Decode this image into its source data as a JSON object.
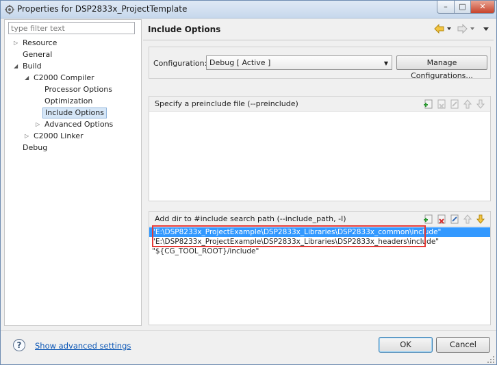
{
  "window": {
    "title": "Properties for DSP2833x_ProjectTemplate",
    "minimize_glyph": "–",
    "maximize_glyph": "□",
    "close_glyph": "✕"
  },
  "left": {
    "filter_placeholder": "type filter text",
    "tree": [
      {
        "label": "Resource",
        "expander": "▷"
      },
      {
        "label": "General",
        "expander": ""
      },
      {
        "label": "Build",
        "expander": "◢"
      },
      {
        "label": "C2000 Compiler",
        "expander": "◢"
      },
      {
        "label": "Processor Options",
        "expander": ""
      },
      {
        "label": "Optimization",
        "expander": ""
      },
      {
        "label": "Include Options",
        "expander": "",
        "selected": true
      },
      {
        "label": "Advanced Options",
        "expander": "▷"
      },
      {
        "label": "C2000 Linker",
        "expander": "▷"
      },
      {
        "label": "Debug",
        "expander": ""
      }
    ]
  },
  "right": {
    "title": "Include Options",
    "configuration": {
      "label": "Configuration:",
      "value": "Debug  [ Active ]",
      "manage_label": "Manage Configurations..."
    },
    "preinclude": {
      "title": "Specify a preinclude file (--preinclude)",
      "items": []
    },
    "include_path": {
      "title": "Add dir to #include search path (--include_path, -I)",
      "items": [
        "\"E:\\DSP8233x_ProjectExample\\DSP2833x_Libraries\\DSP2833x_common\\include\"",
        "\"E:\\DSP8233x_ProjectExample\\DSP2833x_Libraries\\DSP2833x_headers\\include\"",
        "\"${CG_TOOL_ROOT}/include\""
      ],
      "selected_index": 0
    }
  },
  "footer": {
    "help_glyph": "?",
    "show_advanced": "Show advanced settings",
    "ok": "OK",
    "cancel": "Cancel"
  },
  "colors": {
    "selection": "#3399ff",
    "highlight_box": "#e53935",
    "link": "#0b56b5"
  }
}
